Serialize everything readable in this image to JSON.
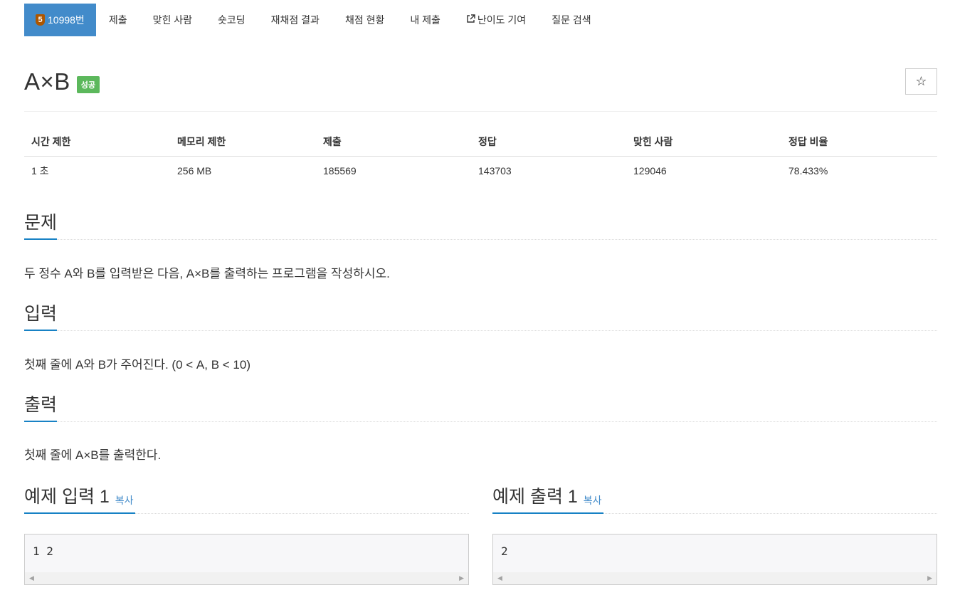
{
  "nav": {
    "problem_tab": {
      "tier": "5",
      "label": "10998번"
    },
    "items": [
      {
        "id": "submit",
        "label": "제출"
      },
      {
        "id": "solvers",
        "label": "맞힌 사람"
      },
      {
        "id": "shortcoding",
        "label": "숏코딩"
      },
      {
        "id": "rejudge",
        "label": "재채점 결과"
      },
      {
        "id": "status",
        "label": "채점 현황"
      },
      {
        "id": "my-submit",
        "label": "내 제출"
      },
      {
        "id": "difficulty",
        "label": "난이도 기여",
        "icon": "external-link-icon"
      },
      {
        "id": "question-search",
        "label": "질문 검색"
      }
    ],
    "accent_color": "#428bca",
    "tier_color": "#ad5600"
  },
  "problem": {
    "title": "A×B",
    "status_badge": "성공",
    "status_color": "#5cb85c",
    "star_icon": "☆"
  },
  "info": {
    "headers": [
      "시간 제한",
      "메모리 제한",
      "제출",
      "정답",
      "맞힌 사람",
      "정답 비율"
    ],
    "values": [
      "1 초",
      "256 MB",
      "185569",
      "143703",
      "129046",
      "78.433%"
    ]
  },
  "sections": {
    "description": {
      "heading": "문제",
      "text": "두 정수 A와 B를 입력받은 다음, A×B를 출력하는 프로그램을 작성하시오."
    },
    "input": {
      "heading": "입력",
      "text": "첫째 줄에 A와 B가 주어진다. (0 < A, B < 10)"
    },
    "output": {
      "heading": "출력",
      "text": "첫째 줄에 A×B를 출력한다."
    }
  },
  "samples": {
    "input": {
      "heading": "예제 입력 1",
      "copy_label": "복사",
      "content": "1 2"
    },
    "output": {
      "heading": "예제 출력 1",
      "copy_label": "복사",
      "content": "2"
    }
  }
}
